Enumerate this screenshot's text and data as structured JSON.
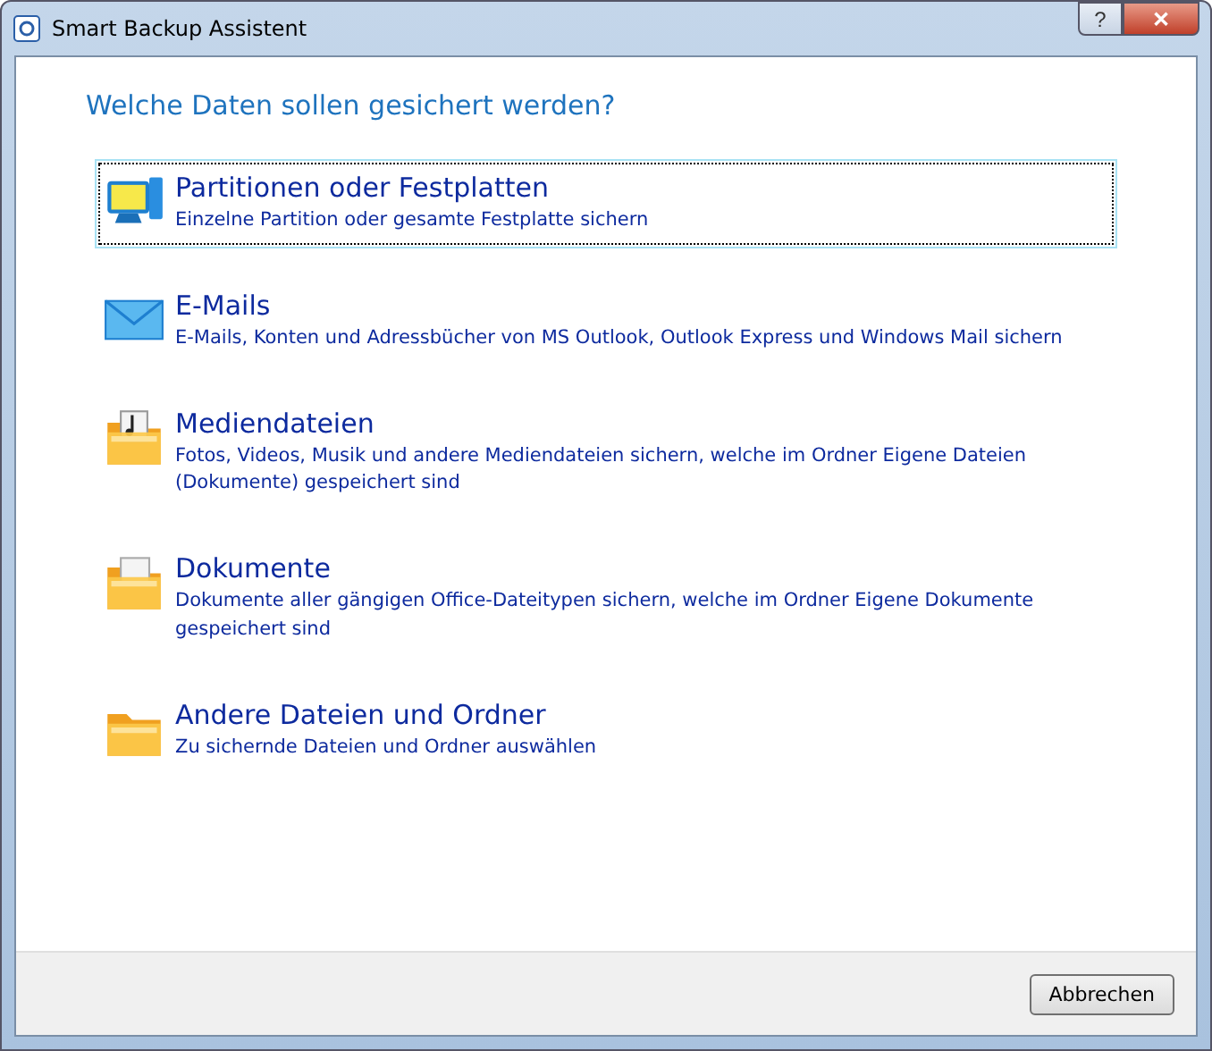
{
  "window": {
    "title": "Smart Backup Assistent",
    "controls": [
      "?",
      "✕"
    ]
  },
  "heading": "Welche Daten sollen gesichert werden?",
  "options": [
    {
      "kind": "partitions",
      "title": "Partitionen oder Festplatten",
      "description": "Einzelne Partition oder gesamte Festplatte sichern",
      "selected": true
    },
    {
      "kind": "email",
      "title": "E-Mails",
      "description": "E-Mails, Konten und Adressbücher von MS Outlook, Outlook Express und Windows Mail sichern",
      "selected": false
    },
    {
      "kind": "media",
      "title": "Mediendateien",
      "description": "Fotos, Videos, Musik und andere Mediendateien sichern, welche im Ordner Eigene Dateien (Dokumente) gespeichert sind",
      "selected": false
    },
    {
      "kind": "documents",
      "title": "Dokumente",
      "description": "Dokumente aller gängigen Office-Dateitypen sichern, welche im Ordner Eigene Dokumente gespeichert sind",
      "selected": false
    },
    {
      "kind": "files",
      "title": "Andere Dateien und Ordner",
      "description": "Zu sichernde Dateien und Ordner auswählen",
      "selected": false
    }
  ],
  "buttons": [
    "Abbrechen"
  ]
}
